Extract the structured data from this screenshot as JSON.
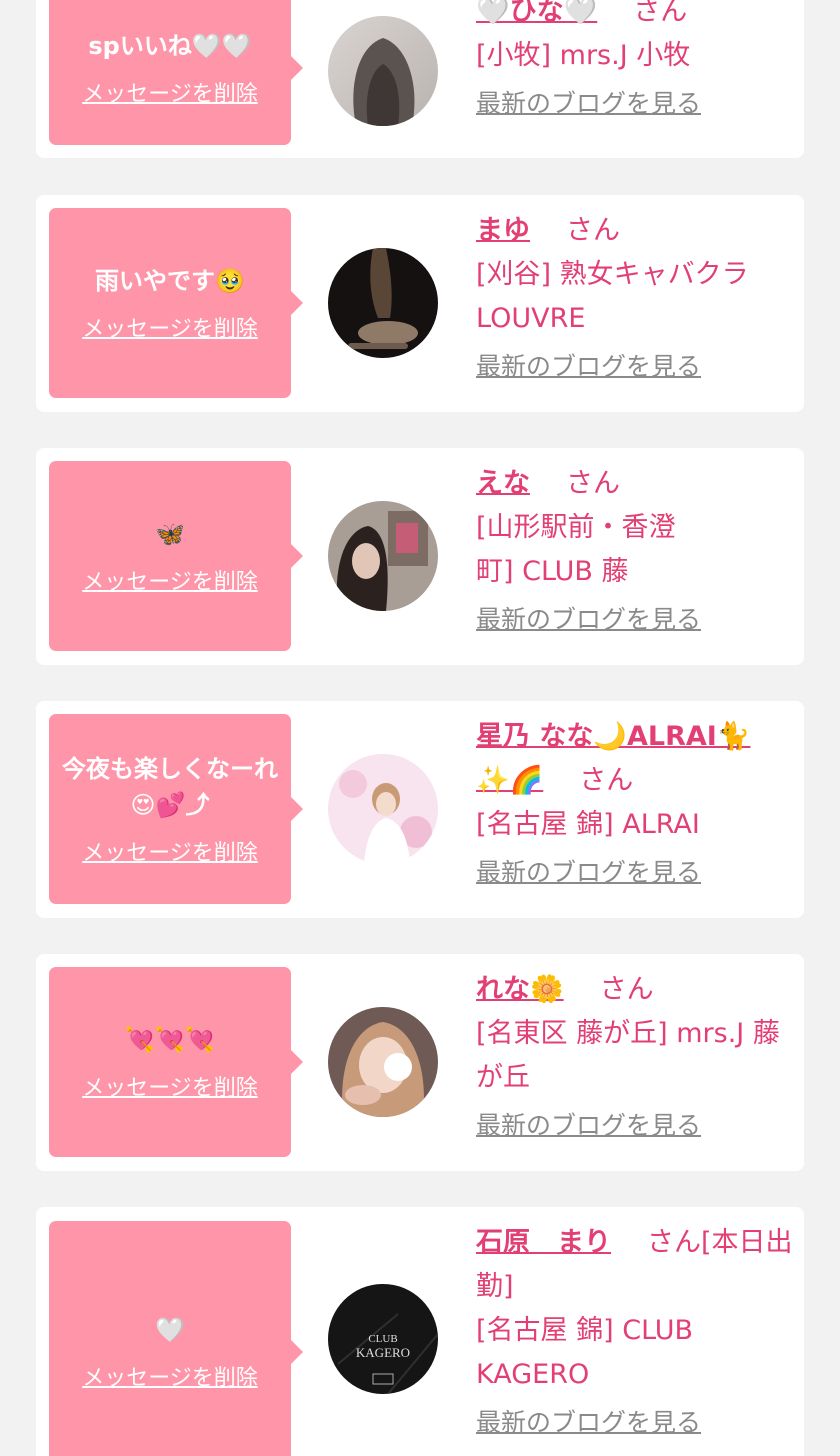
{
  "delete_label": "メッセージを削除",
  "honorific": "さん",
  "blog_label": "最新のブログを見る",
  "colors": {
    "background": "#f2f2f2",
    "card": "#ffffff",
    "bubble": "#ff95a8",
    "accent_text": "#e23f74",
    "link_gray": "#8a8a8a"
  },
  "items": [
    {
      "message": "spいいね🤍🤍",
      "name": "🤍ひな🤍",
      "name_suffix": "",
      "shop": "[小牧] mrs.J 小牧"
    },
    {
      "message": "雨いやです🥹",
      "name": "まゆ",
      "name_suffix": "",
      "shop": "[刈谷] 熟女キャバクラ LOUVRE"
    },
    {
      "message": "🦋",
      "name": "えな",
      "name_suffix": "",
      "shop": "[山形駅前・香澄町] CLUB 藤"
    },
    {
      "message": "今夜も楽しくなーれ😍💕⤴",
      "name": "星乃 なな🌙ALRAI🐈✨🌈",
      "name_suffix": "",
      "shop": "[名古屋 錦] ALRAI"
    },
    {
      "message": "💘💘💘",
      "name": "れな🌼",
      "name_suffix": "",
      "shop": "[名東区 藤が丘] mrs.J 藤が丘"
    },
    {
      "message": "🤍",
      "name": "石原　まり",
      "name_suffix": "[本日出勤]",
      "shop": "[名古屋 錦] CLUB KAGERO"
    }
  ]
}
